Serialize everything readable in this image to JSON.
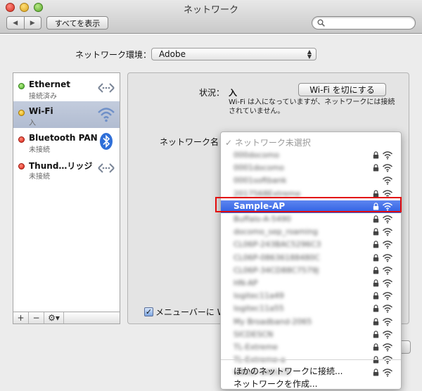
{
  "window": {
    "title": "ネットワーク",
    "show_all": "すべてを表示",
    "nav_back": "◀",
    "nav_forward": "▶",
    "search_placeholder": ""
  },
  "location": {
    "label": "ネットワーク環境：",
    "value": "Adobe"
  },
  "sidebar": {
    "services": [
      {
        "name": "Ethernet",
        "status": "接続済み",
        "indicator": "green",
        "icon": "ethernet-icon"
      },
      {
        "name": "Wi-Fi",
        "status": "入",
        "indicator": "amber",
        "icon": "wifi-icon",
        "selected": true
      },
      {
        "name": "Bluetooth PAN",
        "status": "未接続",
        "indicator": "red",
        "icon": "bluetooth-icon"
      },
      {
        "name": "Thund…リッジ",
        "status": "未接続",
        "indicator": "red",
        "icon": "thunderbolt-bridge-icon"
      }
    ],
    "tools": {
      "add": "+",
      "remove": "−",
      "gear": "⚙▾"
    }
  },
  "detail": {
    "status_label": "状況：",
    "status_value": "入",
    "wifi_off_button": "Wi-Fi を切にする",
    "status_description": "Wi-Fi は入になっていますが、ネットワークには接続されていません。",
    "network_name_label": "ネットワーク名：",
    "show_in_menubar_label": "メニューバーに W",
    "show_in_menubar_checked": true
  },
  "network_menu": {
    "header": "✓ ネットワーク未選択",
    "networks": [
      {
        "ssid": "000docomo",
        "locked": true
      },
      {
        "ssid": "0001docomo",
        "locked": true
      },
      {
        "ssid": "0001softbank",
        "locked": false
      },
      {
        "ssid": "2017568Extreme",
        "locked": true
      },
      {
        "ssid": "Sample-AP",
        "locked": true,
        "highlighted": true
      },
      {
        "ssid": "Buffalo-A-5490",
        "locked": true
      },
      {
        "ssid": "docomo_sep_roaming",
        "locked": true
      },
      {
        "ssid": "CL06P-243BAC5296C3",
        "locked": true
      },
      {
        "ssid": "CL06P-08636188480C",
        "locked": true
      },
      {
        "ssid": "CL06P-34CD88C7579J",
        "locked": true
      },
      {
        "ssid": "HN-AP",
        "locked": true
      },
      {
        "ssid": "logitec11a49",
        "locked": true
      },
      {
        "ssid": "logitec11a55",
        "locked": true
      },
      {
        "ssid": "My Broadband-2065",
        "locked": true
      },
      {
        "ssid": "SICDESCN",
        "locked": true
      },
      {
        "ssid": "TL-Extreme",
        "locked": true
      },
      {
        "ssid": "TL-Extreme-a",
        "locked": true
      },
      {
        "ssid": "UBoat-SA81C0",
        "locked": true
      }
    ],
    "join_other": "ほかのネットワークに接続...",
    "create_network": "ネットワークを作成..."
  }
}
